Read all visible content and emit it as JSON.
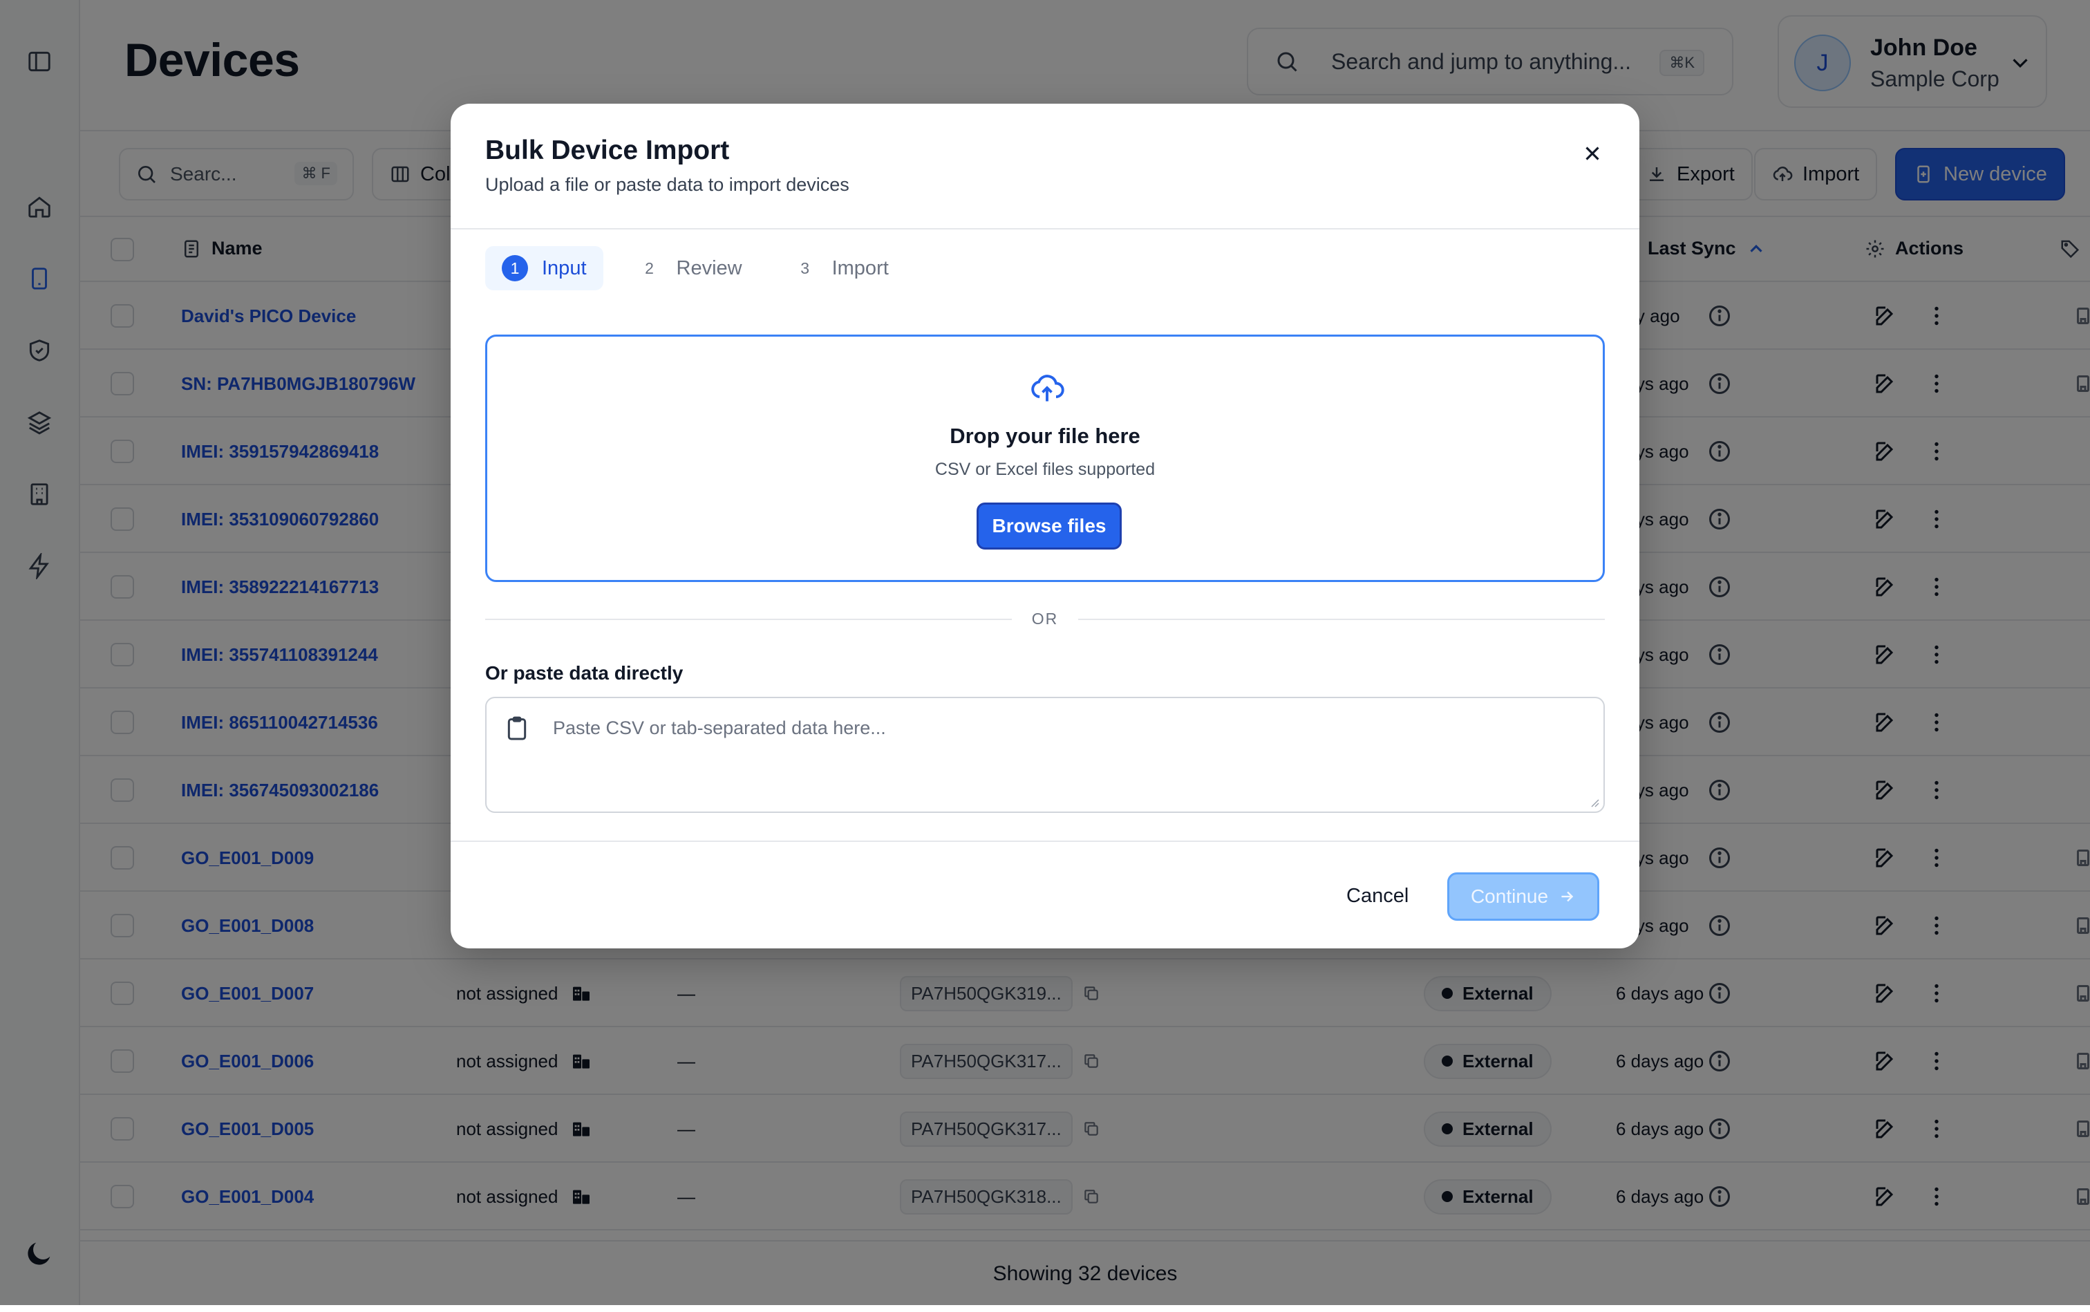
{
  "header": {
    "page_title": "Devices",
    "search_placeholder": "Search and jump to anything...",
    "search_shortcut": "⌘K",
    "user": {
      "initial": "J",
      "name": "John Doe",
      "org": "Sample Corp"
    }
  },
  "toolbar": {
    "search_placeholder": "Searc...",
    "search_shortcut": "⌘ F",
    "columns_label": "Colu",
    "export_label": "Export",
    "import_label": "Import",
    "new_device_label": "New device"
  },
  "table": {
    "headers": {
      "name": "Name",
      "last_sync": "Last Sync",
      "actions": "Actions"
    },
    "rows": [
      {
        "name": "David's PICO Device",
        "assigned": "",
        "dash": "",
        "serial": "",
        "source": "",
        "sync": "day ago"
      },
      {
        "name": "SN: PA7HB0MGJB180796W",
        "assigned": "",
        "dash": "",
        "serial": "",
        "source": "",
        "sync": "days ago"
      },
      {
        "name": "IMEI: 359157942869418",
        "assigned": "",
        "dash": "",
        "serial": "",
        "source": "",
        "sync": "days ago"
      },
      {
        "name": "IMEI: 353109060792860",
        "assigned": "",
        "dash": "",
        "serial": "",
        "source": "",
        "sync": "days ago"
      },
      {
        "name": "IMEI: 358922214167713",
        "assigned": "",
        "dash": "",
        "serial": "",
        "source": "",
        "sync": "days ago"
      },
      {
        "name": "IMEI: 355741108391244",
        "assigned": "",
        "dash": "",
        "serial": "",
        "source": "",
        "sync": "days ago"
      },
      {
        "name": "IMEI: 865110042714536",
        "assigned": "",
        "dash": "",
        "serial": "",
        "source": "",
        "sync": "days ago"
      },
      {
        "name": "IMEI: 356745093002186",
        "assigned": "",
        "dash": "",
        "serial": "",
        "source": "",
        "sync": "days ago"
      },
      {
        "name": "GO_E001_D009",
        "assigned": "",
        "dash": "",
        "serial": "",
        "source": "",
        "sync": "days ago"
      },
      {
        "name": "GO_E001_D008",
        "assigned": "",
        "dash": "",
        "serial": "",
        "source": "",
        "sync": "days ago"
      },
      {
        "name": "GO_E001_D007",
        "assigned": "not assigned",
        "dash": "—",
        "serial": "PA7H50QGK319...",
        "source": "External",
        "sync": "6 days ago"
      },
      {
        "name": "GO_E001_D006",
        "assigned": "not assigned",
        "dash": "—",
        "serial": "PA7H50QGK317...",
        "source": "External",
        "sync": "6 days ago"
      },
      {
        "name": "GO_E001_D005",
        "assigned": "not assigned",
        "dash": "—",
        "serial": "PA7H50QGK317...",
        "source": "External",
        "sync": "6 days ago"
      },
      {
        "name": "GO_E001_D004",
        "assigned": "not assigned",
        "dash": "—",
        "serial": "PA7H50QGK318...",
        "source": "External",
        "sync": "6 days ago"
      }
    ],
    "footer": "Showing 32 devices"
  },
  "modal": {
    "title": "Bulk Device Import",
    "subtitle": "Upload a file or paste data to import devices",
    "steps": [
      {
        "num": "1",
        "label": "Input",
        "active": true
      },
      {
        "num": "2",
        "label": "Review",
        "active": false
      },
      {
        "num": "3",
        "label": "Import",
        "active": false
      }
    ],
    "dropzone": {
      "title": "Drop your file here",
      "subtitle": "CSV or Excel files supported",
      "button": "Browse files"
    },
    "or_text": "OR",
    "paste_label": "Or paste data directly",
    "paste_placeholder": "Paste CSV or tab-separated data here...",
    "cancel_label": "Cancel",
    "continue_label": "Continue"
  },
  "colors": {
    "accent": "#2563eb",
    "link": "#1d4ed8",
    "continue_disabled": "#93c5fd"
  }
}
